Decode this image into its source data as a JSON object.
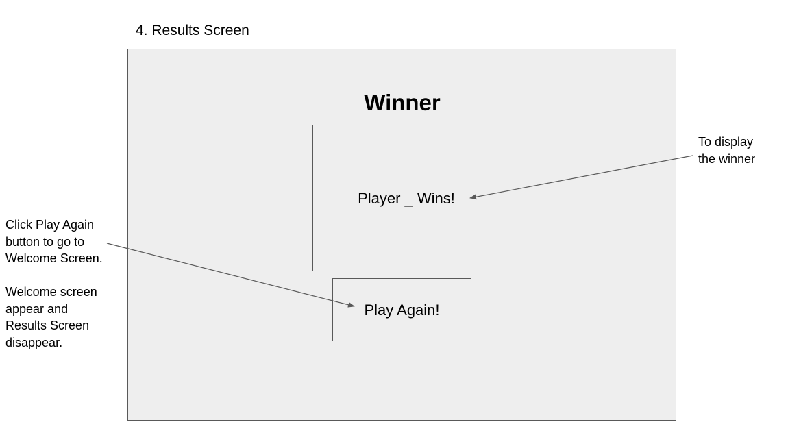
{
  "section_title": "4. Results Screen",
  "screen": {
    "heading": "Winner",
    "winner_text": "Player _ Wins!",
    "play_again_label": "Play Again!"
  },
  "annotations": {
    "winner_note": [
      "To display",
      "the winner"
    ],
    "play_again_note": {
      "paragraph1": [
        "Click Play Again",
        "button to go to",
        "Welcome Screen."
      ],
      "paragraph2": [
        "Welcome  screen",
        "appear and",
        "Results Screen",
        "disappear."
      ]
    }
  },
  "colors": {
    "screen_background": "#eeeeee",
    "border": "#595959",
    "arrow": "#595959"
  }
}
